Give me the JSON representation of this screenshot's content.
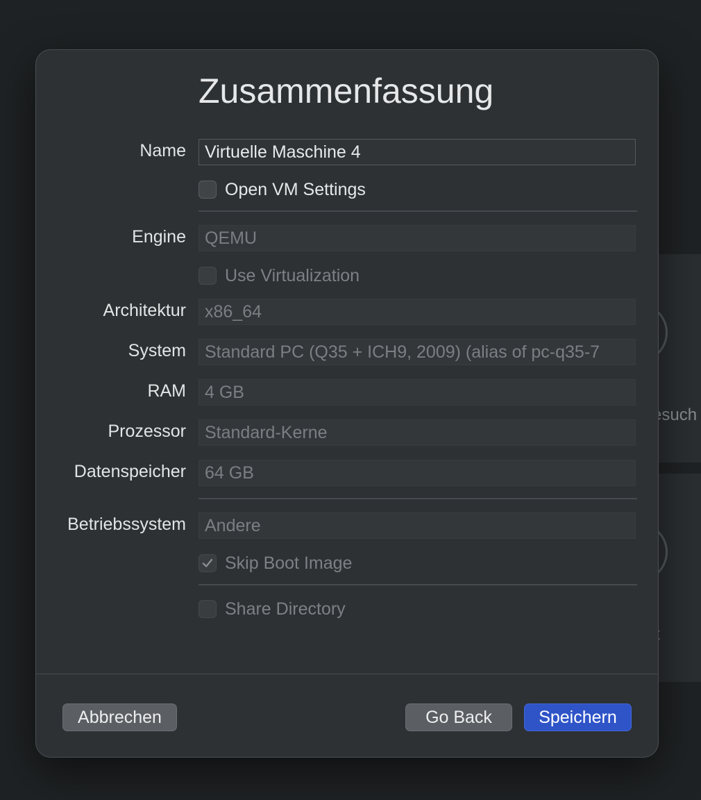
{
  "background": {
    "card1_text": "esuch",
    "card2_text": "t"
  },
  "dialog": {
    "title": "Zusammenfassung",
    "name": {
      "label": "Name",
      "value": "Virtuelle Maschine 4"
    },
    "open_vm_settings": {
      "label": "Open VM Settings",
      "checked": false
    },
    "engine": {
      "label": "Engine",
      "value": "QEMU"
    },
    "use_virtualization": {
      "label": "Use Virtualization",
      "checked": false
    },
    "architecture": {
      "label": "Architektur",
      "value": "x86_64"
    },
    "system": {
      "label": "System",
      "value": "Standard PC (Q35 + ICH9, 2009) (alias of pc-q35-7"
    },
    "ram": {
      "label": "RAM",
      "value": "4 GB"
    },
    "processor": {
      "label": "Prozessor",
      "value": "Standard-Kerne"
    },
    "storage": {
      "label": "Datenspeicher",
      "value": "64 GB"
    },
    "os": {
      "label": "Betriebssystem",
      "value": "Andere"
    },
    "skip_boot_image": {
      "label": "Skip Boot Image",
      "checked": true
    },
    "share_directory": {
      "label": "Share Directory",
      "checked": false
    },
    "buttons": {
      "cancel": "Abbrechen",
      "back": "Go Back",
      "save": "Speichern"
    }
  },
  "colors": {
    "primary_button": "#2f54c8",
    "dialog_bg": "#2d3134",
    "window_bg": "#1f2224"
  }
}
